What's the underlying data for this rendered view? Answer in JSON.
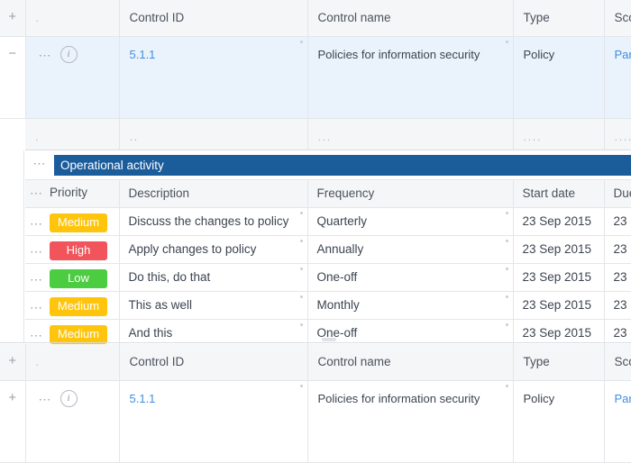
{
  "outer_table": {
    "columns": [
      {
        "key": "gutter",
        "label": ""
      },
      {
        "key": "handle",
        "label": "."
      },
      {
        "key": "control_id",
        "label": "Control ID"
      },
      {
        "key": "control_name",
        "label": "Control name"
      },
      {
        "key": "type",
        "label": "Type"
      },
      {
        "key": "scope",
        "label": "Sco"
      }
    ],
    "add_row_glyph": "+",
    "collapse_glyph": "−",
    "expand_glyph": "+",
    "row_menu_glyph": "⋯",
    "info_glyph": "i",
    "rows": [
      {
        "gutter": "−",
        "handle": "⋯",
        "control_id": "5.1.1",
        "control_name": "Policies for information security",
        "type": "Policy",
        "scope": "Par",
        "selected": true
      },
      {
        "gutter": "+",
        "handle": "⋯",
        "control_id": "5.1.1",
        "control_name": "Policies for information security",
        "type": "Policy",
        "scope": "Par",
        "selected": false
      }
    ],
    "placeholder_row": {
      "handle": ".",
      "control_id": "..",
      "control_name": "...",
      "type": "....",
      "scope": "....."
    }
  },
  "nested_table": {
    "banner_label": "Operational activity",
    "banner_color": "#1b5c9b",
    "row_menu_glyph": "⋯",
    "columns": [
      {
        "key": "priority",
        "label": "Priority"
      },
      {
        "key": "description",
        "label": "Description"
      },
      {
        "key": "frequency",
        "label": "Frequency"
      },
      {
        "key": "start_date",
        "label": "Start date"
      },
      {
        "key": "due_date",
        "label": "Due"
      }
    ],
    "rows": [
      {
        "priority": "Medium",
        "priority_color": "#ffc40c",
        "description": "Discuss the changes to policy",
        "frequency": "Quarterly",
        "start_date": "23 Sep 2015",
        "due_date": "23 "
      },
      {
        "priority": "High",
        "priority_color": "#f2545b",
        "description": "Apply changes to policy",
        "frequency": "Annually",
        "start_date": "23 Sep 2015",
        "due_date": "23 "
      },
      {
        "priority": "Low",
        "priority_color": "#4ccc41",
        "description": "Do this, do that",
        "frequency": "One-off",
        "start_date": "23 Sep 2015",
        "due_date": "23 "
      },
      {
        "priority": "Medium",
        "priority_color": "#ffc40c",
        "description": "This as well",
        "frequency": "Monthly",
        "start_date": "23 Sep 2015",
        "due_date": "23 "
      },
      {
        "priority": "Medium",
        "priority_color": "#ffc40c",
        "description": "And this",
        "frequency": "One-off",
        "start_date": "23 Sep 2015",
        "due_date": "23 "
      }
    ]
  },
  "theme": {
    "selected_row_bg": "#eaf2fc",
    "header_bg": "#f5f6f7",
    "border": "#e3e6ea",
    "link_color": "#3f8fe0",
    "text_color": "#3c4450"
  }
}
